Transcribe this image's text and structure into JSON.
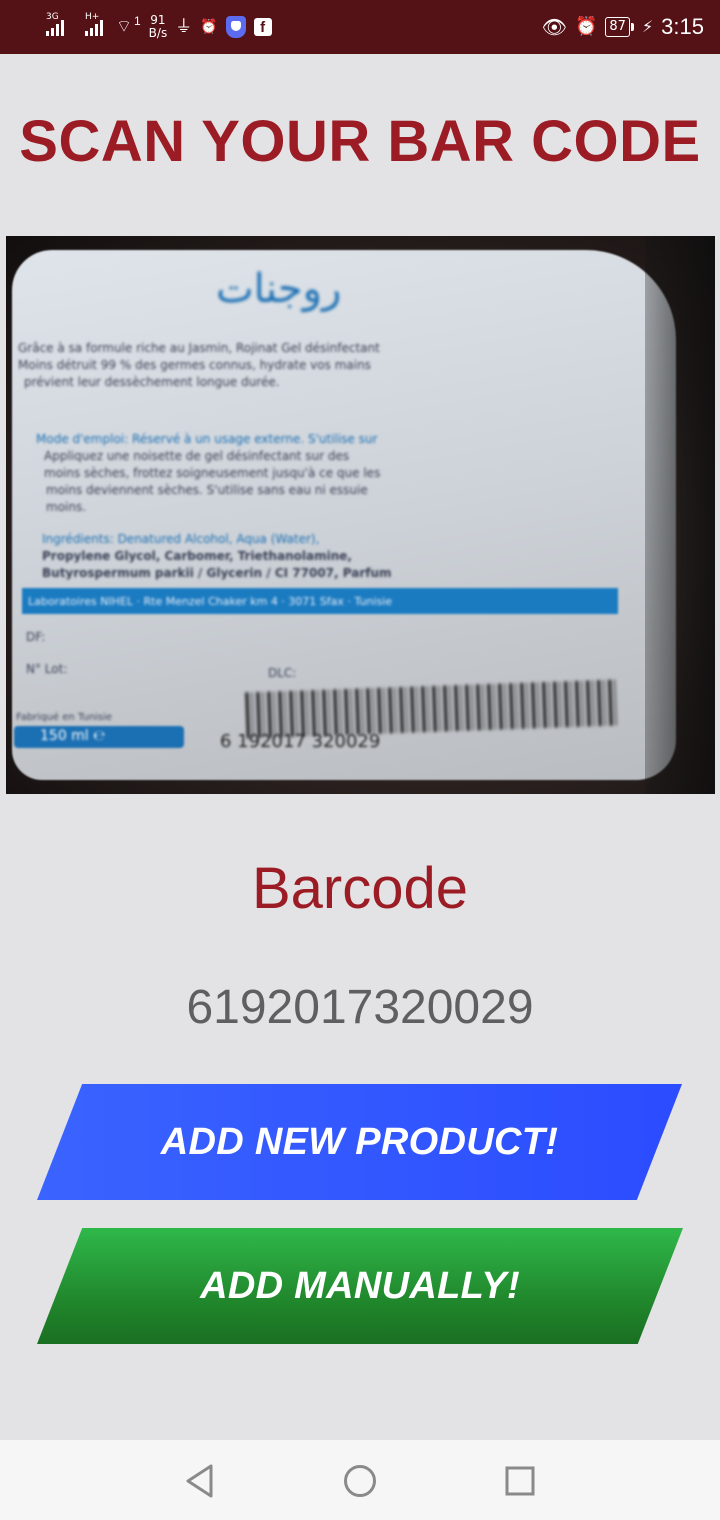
{
  "status_bar": {
    "sim1_tag": "3G",
    "sim2_tag": "H+",
    "hotspot_count": "1",
    "speed_value": "91",
    "speed_unit": "B/s",
    "usb_icon": "usb-icon",
    "alarm_icon": "alarm-icon",
    "eye_icon": "eye-comfort-icon",
    "battery_level": "87",
    "time": "3:15"
  },
  "header": {
    "title": "SCAN YOUR BAR CODE"
  },
  "scan_preview": {
    "arabic_title": "روجنات",
    "text_lines": [
      "Grâce à sa formule riche au Jasmin, Rojinat Gel désinfectant",
      "Moins détruit 99 % des germes connus, hydrate vos mains",
      "prévient leur dessèchement longue durée.",
      "Mode d'emploi: Réservé à un usage externe. S'utilise sur",
      "Appliquez une noisette de gel désinfectant sur des",
      "moins sèches, frottez soigneusement jusqu'à ce que les",
      "moins deviennent sèches. S'utilise sans eau ni essuie",
      "moins.",
      "Ingrédients: Denatured Alcohol, Aqua (Water),",
      "Propylene Glycol, Carbomer, Triethanolamine,",
      "Butyrospermum parkii / Glycerin / CI 77007, Parfum"
    ],
    "band_text": "Laboratoires NIHEL · Rte Menzel Chaker km 4 · 3071 Sfax · Tunisie",
    "df_label": "DF:",
    "lot_label": "N° Lot:",
    "made_in": "Fabriqué en Tunisie",
    "dlc_label": "DLC:",
    "volume": "150 ml ℮",
    "barcode_digits": "6 192017 320029"
  },
  "barcode_section": {
    "label": "Barcode",
    "value": "6192017320029"
  },
  "buttons": {
    "add_new_product": "ADD NEW PRODUCT!",
    "add_manually": "ADD MANUALLY!"
  },
  "nav_bar": {
    "back_icon": "back-triangle-icon",
    "home_icon": "home-circle-icon",
    "recents_icon": "recents-square-icon"
  },
  "colors": {
    "status_bar_bg": "#541116",
    "title_red": "#9b1c24",
    "primary_blue": "#2b4cff",
    "success_green": "#21892d",
    "page_bg": "#e3e3e5"
  }
}
